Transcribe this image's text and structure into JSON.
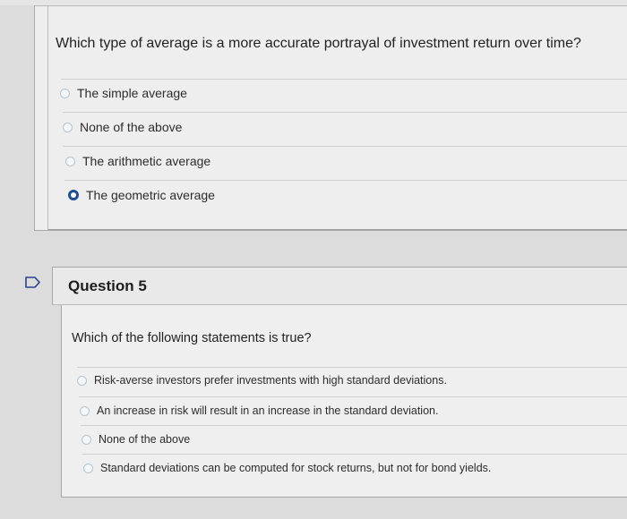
{
  "question4": {
    "text": "Which type of average is  a more accurate portrayal of investment return over time?",
    "options": [
      {
        "label": "The simple average",
        "selected": false
      },
      {
        "label": "None of the above",
        "selected": false
      },
      {
        "label": "The arithmetic average",
        "selected": false
      },
      {
        "label": "The geometric average",
        "selected": true
      }
    ]
  },
  "question5": {
    "title": "Question 5",
    "text": "Which of the following statements is true?",
    "options": [
      {
        "label": "Risk-averse investors prefer investments with high standard deviations.",
        "selected": false
      },
      {
        "label": "An increase in risk will result in an increase in the standard deviation.",
        "selected": false
      },
      {
        "label": "None of the above",
        "selected": false
      },
      {
        "label": "Standard deviations can be computed for stock returns, but not for bond yields.",
        "selected": false
      }
    ]
  },
  "colors": {
    "selected_radio": "#1f4e94",
    "background": "#dcdcdc",
    "card": "#eeeeee"
  }
}
